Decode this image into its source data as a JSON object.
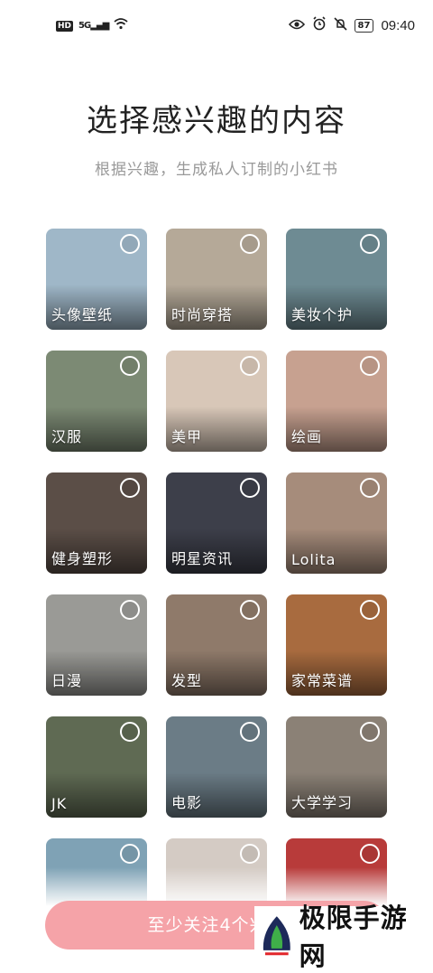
{
  "status_bar": {
    "left_badges": [
      "HD",
      "5G"
    ],
    "battery": "87",
    "time": "09:40"
  },
  "header": {
    "title": "选择感兴趣的内容",
    "subtitle": "根据兴趣，生成私人订制的小红书"
  },
  "interests": [
    {
      "label": "头像壁纸",
      "bg": "#9fb7c8"
    },
    {
      "label": "时尚穿搭",
      "bg": "#b5a998"
    },
    {
      "label": "美妆个护",
      "bg": "#6e8b93"
    },
    {
      "label": "汉服",
      "bg": "#7c8a74"
    },
    {
      "label": "美甲",
      "bg": "#d8c7b8"
    },
    {
      "label": "绘画",
      "bg": "#c7a190"
    },
    {
      "label": "健身塑形",
      "bg": "#5b4e47"
    },
    {
      "label": "明星资讯",
      "bg": "#3d3f4a"
    },
    {
      "label": "Lolita",
      "bg": "#a68c7b"
    },
    {
      "label": "日漫",
      "bg": "#9a9a96"
    },
    {
      "label": "发型",
      "bg": "#8f7a6a"
    },
    {
      "label": "家常菜谱",
      "bg": "#a86b3f"
    },
    {
      "label": "JK",
      "bg": "#5f6a53"
    },
    {
      "label": "电影",
      "bg": "#6b7c86"
    },
    {
      "label": "大学学习",
      "bg": "#8b8176"
    },
    {
      "label": "",
      "bg": "#7fa2b5"
    },
    {
      "label": "",
      "bg": "#d4cbc4"
    },
    {
      "label": "",
      "bg": "#b83b3a"
    }
  ],
  "cta": {
    "label": "至少关注4个兴趣"
  },
  "watermark": {
    "text": "极限手游网"
  }
}
